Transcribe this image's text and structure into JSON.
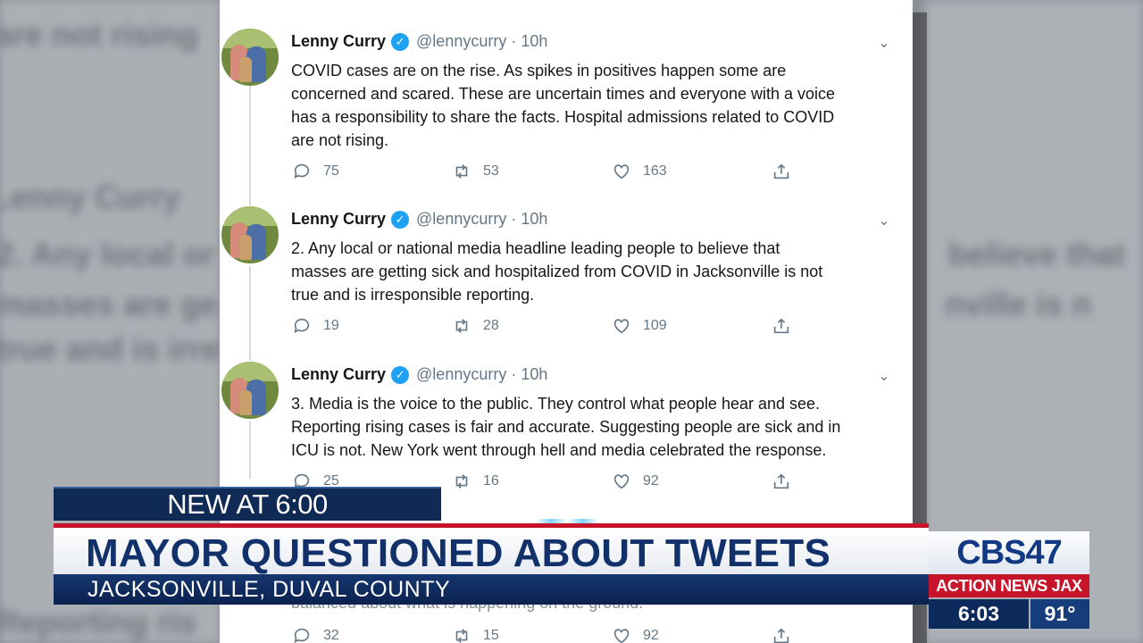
{
  "background": {
    "blurred_text": [
      "are not rising",
      "Lenny Curry",
      "2.  Any local or",
      "believe that",
      "masses are ge",
      "nville is n",
      "true and is irre",
      "Reporting ris"
    ]
  },
  "tweets": [
    {
      "name": "Lenny Curry",
      "handle": "@lennycurry",
      "separator": "·",
      "time": "10h",
      "text": "COVID cases are on the rise. As spikes in positives happen some are\nconcerned and scared.  These are uncertain times and everyone with a voice\nhas a responsibility to share the facts.  Hospital admissions related to COVID\nare not rising.",
      "replies": "75",
      "retweets": "53",
      "likes": "163"
    },
    {
      "name": "Lenny Curry",
      "handle": "@lennycurry",
      "separator": "·",
      "time": "10h",
      "text": "2.  Any local or national media headline leading people to believe that\nmasses are getting sick and hospitalized from COVID in Jacksonville is not\ntrue and is irresponsible reporting.",
      "replies": "19",
      "retweets": "28",
      "likes": "109"
    },
    {
      "name": "Lenny Curry",
      "handle": "@lennycurry",
      "separator": "·",
      "time": "10h",
      "text": "3.  Media is the voice to the public.  They control what people hear and see.\nReporting rising cases is fair and accurate.  Suggesting people are sick and in\nICU is not.  New York went through hell and media celebrated the response.",
      "replies": "25",
      "retweets": "16",
      "likes": "92"
    },
    {
      "partial_text": "balanced about what is happening on the ground.",
      "replies": "32",
      "retweets": "15",
      "likes": "92"
    }
  ],
  "icons": {
    "verified": "verified-badge-icon",
    "chevron": "chevron-down-icon",
    "reply": "reply-icon",
    "retweet": "retweet-icon",
    "like": "heart-icon",
    "share": "share-icon"
  },
  "lower_third": {
    "tag": "NEW AT 6:00",
    "headline": "MAYOR QUESTIONED ABOUT TWEETS",
    "location": "JACKSONVILLE, DUVAL COUNTY",
    "logo": "CBS47",
    "brand": "ACTION NEWS JAX",
    "time": "6:03",
    "temperature": "91°"
  },
  "colors": {
    "twitter_blue": "#1da1f2",
    "news_navy": "#0f2a55",
    "news_red": "#c8142a"
  }
}
